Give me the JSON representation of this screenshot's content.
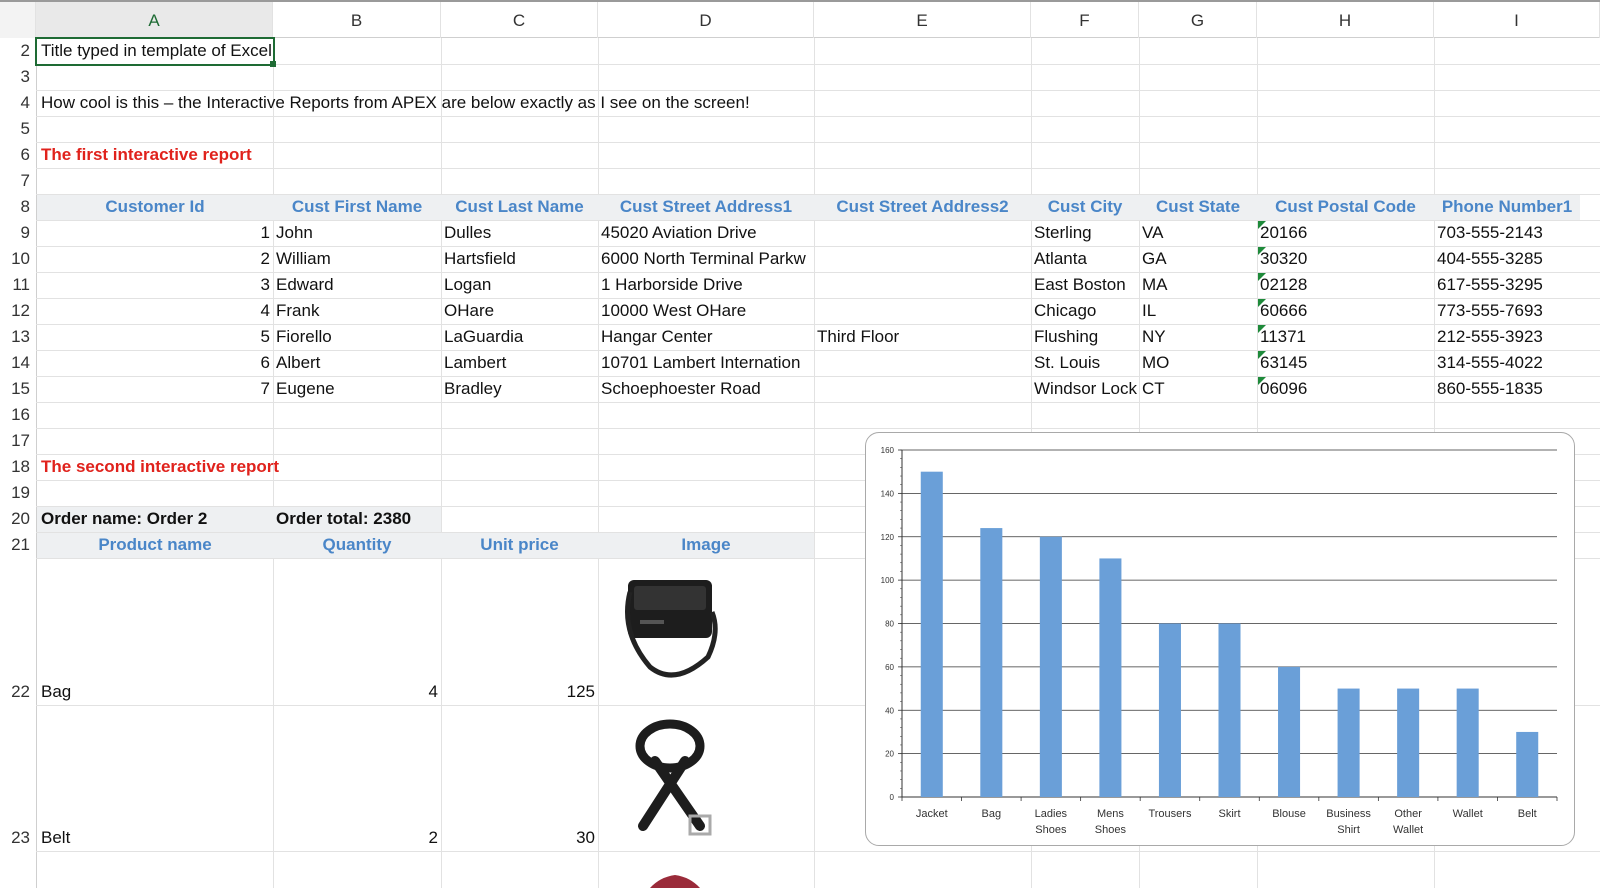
{
  "columns": [
    "A",
    "B",
    "C",
    "D",
    "E",
    "F",
    "G",
    "H",
    "I"
  ],
  "rows": [
    "2",
    "3",
    "4",
    "5",
    "6",
    "7",
    "8",
    "9",
    "10",
    "11",
    "12",
    "13",
    "14",
    "15",
    "16",
    "17",
    "18",
    "19",
    "20",
    "21",
    "22",
    "23"
  ],
  "selected_cell_text": "Title typed in template of Excel",
  "intro_text": "How cool is this – the Interactive Reports from APEX are below exactly as I see on the screen!",
  "report1_title": "The first interactive report",
  "report1_headers": [
    "Customer Id",
    "Cust First Name",
    "Cust Last Name",
    "Cust Street Address1",
    "Cust Street Address2",
    "Cust City",
    "Cust State",
    "Cust Postal Code",
    "Phone Number1"
  ],
  "report1_rows": [
    [
      "1",
      "John",
      "Dulles",
      "45020 Aviation Drive",
      "",
      "Sterling",
      "VA",
      "20166",
      "703-555-2143"
    ],
    [
      "2",
      "William",
      "Hartsfield",
      "6000 North Terminal Parkw",
      "",
      "Atlanta",
      "GA",
      "30320",
      "404-555-3285"
    ],
    [
      "3",
      "Edward",
      "Logan",
      "1 Harborside Drive",
      "",
      "East Boston",
      "MA",
      "02128",
      "617-555-3295"
    ],
    [
      "4",
      "Frank",
      "OHare",
      "10000 West OHare",
      "",
      "Chicago",
      "IL",
      "60666",
      "773-555-7693"
    ],
    [
      "5",
      "Fiorello",
      "LaGuardia",
      "Hangar Center",
      "Third Floor",
      "Flushing",
      "NY",
      "11371",
      "212-555-3923"
    ],
    [
      "6",
      "Albert",
      "Lambert",
      "10701 Lambert Internation",
      "",
      "St. Louis",
      "MO",
      "63145",
      "314-555-4022"
    ],
    [
      "7",
      "Eugene",
      "Bradley",
      "Schoephoester Road",
      "",
      "Windsor Lock",
      "CT",
      "06096",
      "860-555-1835"
    ]
  ],
  "report2_title": "The second interactive report",
  "order_name": "Order name: Order 2",
  "order_total": "Order total: 2380",
  "report2_headers": [
    "Product name",
    "Quantity",
    "Unit price",
    "Image"
  ],
  "report2_rows": [
    {
      "product": "Bag",
      "quantity": "4",
      "price": "125",
      "image_icon": "bag-image"
    },
    {
      "product": "Belt",
      "quantity": "2",
      "price": "30",
      "image_icon": "belt-image"
    }
  ],
  "chart_data": {
    "type": "bar",
    "categories": [
      "Jacket",
      "Bag",
      "Ladies Shoes",
      "Mens Shoes",
      "Trousers",
      "Skirt",
      "Blouse",
      "Business Shirt",
      "Other Wallet",
      "Wallet",
      "Belt"
    ],
    "category_lines": [
      [
        "Jacket"
      ],
      [
        "Bag"
      ],
      [
        "Ladies",
        "Shoes"
      ],
      [
        "Mens",
        "Shoes"
      ],
      [
        "Trousers"
      ],
      [
        "Skirt"
      ],
      [
        "Blouse"
      ],
      [
        "Business",
        "Shirt"
      ],
      [
        "Other",
        "Wallet"
      ],
      [
        "Wallet"
      ],
      [
        "Belt"
      ]
    ],
    "values": [
      150,
      124,
      120,
      110,
      80,
      80,
      60,
      50,
      50,
      50,
      30
    ],
    "yticks": [
      "0",
      "20",
      "40",
      "60",
      "80",
      "100",
      "120",
      "140",
      "160"
    ],
    "ylim": [
      0,
      160
    ],
    "grid": true,
    "bar_color": "#6a9fd8"
  },
  "colors": {
    "header_blue": "#4a86c8",
    "title_red": "#e0221c",
    "select_green": "#1e6b34"
  }
}
